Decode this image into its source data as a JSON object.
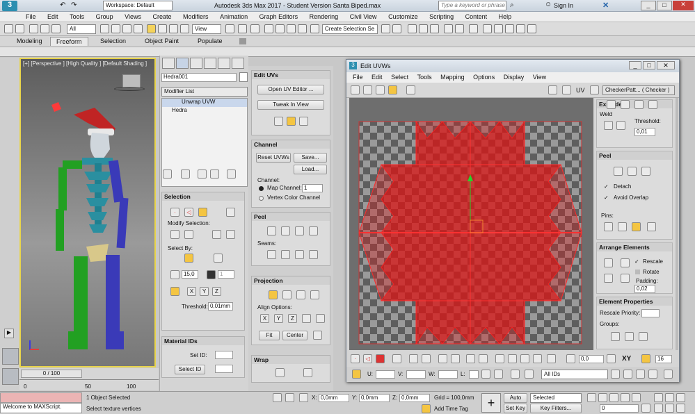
{
  "app": {
    "title": "Autodesk 3ds Max 2017 - Student Version    Santa Biped.max",
    "workspace": "Workspace: Default",
    "search_placeholder": "Type a keyword or phrase",
    "sign_in": "Sign In"
  },
  "menu": [
    "File",
    "Edit",
    "Tools",
    "Group",
    "Views",
    "Create",
    "Modifiers",
    "Animation",
    "Graph Editors",
    "Rendering",
    "Civil View",
    "Customize",
    "Scripting",
    "Content",
    "Help"
  ],
  "toolbar": {
    "filter": "All",
    "ref_coord": "View",
    "selection_set": "Create Selection Se"
  },
  "ribbon_tabs": [
    "Modeling",
    "Freeform",
    "Selection",
    "Object Paint",
    "Populate"
  ],
  "viewport": {
    "label": "[+] [Perspective ] [High Quality ] [Default Shading ]"
  },
  "cmd": {
    "object_name": "Hedra001",
    "modifier_list": "Modifier List",
    "stack": [
      "Unwrap UVW",
      "Hedra"
    ]
  },
  "selection": {
    "title": "Selection",
    "modify_label": "Modify Selection:",
    "select_by": "Select By:",
    "angle": "15,0",
    "threshold_label": "Threshold:",
    "threshold": "0,01mm"
  },
  "material_ids": {
    "title": "Material IDs",
    "set_id": "Set ID:",
    "select_id": "Select ID"
  },
  "edit_uvs": {
    "title": "Edit UVs",
    "open": "Open UV Editor ...",
    "tweak": "Tweak In View"
  },
  "channel": {
    "title": "Channel",
    "reset": "Reset UVWs",
    "save": "Save...",
    "load": "Load...",
    "channel_label": "Channel:",
    "map_channel": "Map Channel:",
    "map_value": "1",
    "vertex_color": "Vertex Color Channel"
  },
  "peel": {
    "title": "Peel",
    "seams": "Seams:"
  },
  "projection": {
    "title": "Projection",
    "align": "Align Options:",
    "fit": "Fit",
    "center": "Center"
  },
  "wrap": {
    "title": "Wrap"
  },
  "uv_editor": {
    "title": "Edit UVWs",
    "menu": [
      "File",
      "Edit",
      "Select",
      "Tools",
      "Mapping",
      "Options",
      "Display",
      "View"
    ],
    "uv_label": "UV",
    "texture": "CheckerPatt... ( Checker )",
    "u": "U:",
    "v": "V:",
    "w": "W:",
    "l": "L:",
    "value": "0,0",
    "ids": "All IDs",
    "spin": "16"
  },
  "uv_right": {
    "explode": "Explode",
    "weld": "Weld",
    "threshold": "Threshold:",
    "threshold_val": "0,01",
    "peel": "Peel",
    "detach": "Detach",
    "avoid": "Avoid Overlap",
    "pins": "Pins:",
    "arrange": "Arrange Elements",
    "rescale": "Rescale",
    "rotate": "Rotate",
    "padding": "Padding:",
    "padding_val": "0,02",
    "elem_props": "Element Properties",
    "rescale_priority": "Rescale Priority:",
    "groups": "Groups:"
  },
  "timeline": {
    "frame": "0 / 100",
    "tick0": "0",
    "tick50": "50",
    "tick100": "100"
  },
  "status": {
    "script": "Welcome to MAXScript.",
    "selected": "1 Object Selected",
    "prompt": "Select texture vertices",
    "x": "X:",
    "x_val": "0,0mm",
    "y": "Y:",
    "y_val": "0,0mm",
    "z": "Z:",
    "z_val": "0,0mm",
    "grid": "Grid = 100,0mm",
    "add_time_tag": "Add Time Tag",
    "auto_key": "Auto Key",
    "set_key": "Set Key",
    "selected_mode": "Selected",
    "key_filters": "Key Filters...",
    "frame": "0"
  },
  "colors": {
    "accent": "#e8d44a",
    "uv_red": "#e02020"
  }
}
